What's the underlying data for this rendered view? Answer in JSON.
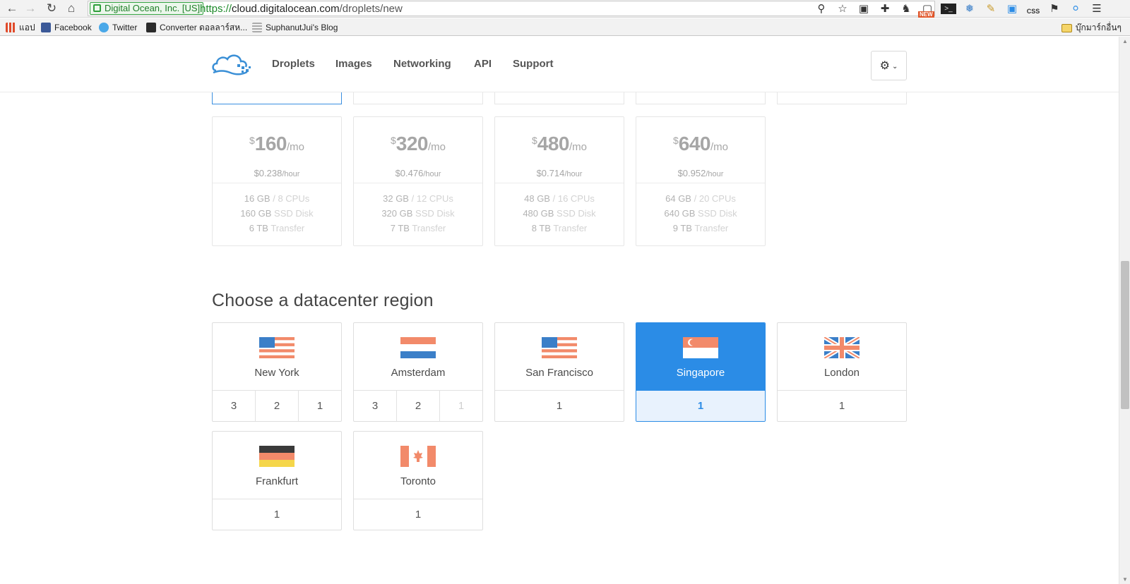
{
  "browser": {
    "ev_label": "Digital Ocean, Inc. [US]",
    "url_scheme": "https://",
    "url_host": "cloud.digitalocean.com",
    "url_path": "/droplets/new",
    "ext_badge_new": "NEW",
    "ext_badge_css": "CSS",
    "bookmarks": [
      {
        "label": "แอป"
      },
      {
        "label": "Facebook"
      },
      {
        "label": "Twitter"
      },
      {
        "label": "Converter ดอลลาร์สห..."
      },
      {
        "label": "SuphanutJui's Blog"
      }
    ],
    "other_bookmarks": "บุ๊กมาร์กอื่นๆ"
  },
  "nav": {
    "links": [
      "Droplets",
      "Images",
      "Networking",
      "API",
      "Support"
    ]
  },
  "sizes": [
    {
      "currency": "$",
      "monthly": "160",
      "per_month": "/mo",
      "hourly": "$0.238",
      "per_hour": "/hour",
      "mem": "16 GB",
      "cpu": "8 CPUs",
      "disk": "160 GB",
      "disk_label": "SSD Disk",
      "transfer": "6 TB",
      "transfer_label": "Transfer"
    },
    {
      "currency": "$",
      "monthly": "320",
      "per_month": "/mo",
      "hourly": "$0.476",
      "per_hour": "/hour",
      "mem": "32 GB",
      "cpu": "12 CPUs",
      "disk": "320 GB",
      "disk_label": "SSD Disk",
      "transfer": "7 TB",
      "transfer_label": "Transfer"
    },
    {
      "currency": "$",
      "monthly": "480",
      "per_month": "/mo",
      "hourly": "$0.714",
      "per_hour": "/hour",
      "mem": "48 GB",
      "cpu": "16 CPUs",
      "disk": "480 GB",
      "disk_label": "SSD Disk",
      "transfer": "8 TB",
      "transfer_label": "Transfer"
    },
    {
      "currency": "$",
      "monthly": "640",
      "per_month": "/mo",
      "hourly": "$0.952",
      "per_hour": "/hour",
      "mem": "64 GB",
      "cpu": "20 CPUs",
      "disk": "640 GB",
      "disk_label": "SSD Disk",
      "transfer": "9 TB",
      "transfer_label": "Transfer"
    }
  ],
  "region": {
    "heading": "Choose a datacenter region",
    "selected": "Singapore",
    "regions": [
      {
        "name": "New York",
        "flag": "us-flag-icon",
        "dcs": [
          "3",
          "2",
          "1"
        ],
        "disabled": []
      },
      {
        "name": "Amsterdam",
        "flag": "netherlands-flag-icon",
        "dcs": [
          "3",
          "2",
          "1"
        ],
        "disabled": [
          "1"
        ]
      },
      {
        "name": "San Francisco",
        "flag": "us-flag-icon",
        "dcs": [
          "1"
        ],
        "disabled": []
      },
      {
        "name": "Singapore",
        "flag": "singapore-flag-icon",
        "dcs": [
          "1"
        ],
        "disabled": []
      },
      {
        "name": "London",
        "flag": "uk-flag-icon",
        "dcs": [
          "1"
        ],
        "disabled": []
      },
      {
        "name": "Frankfurt",
        "flag": "germany-flag-icon",
        "dcs": [
          "1"
        ],
        "disabled": []
      },
      {
        "name": "Toronto",
        "flag": "canada-flag-icon",
        "dcs": [
          "1"
        ],
        "disabled": []
      }
    ]
  },
  "colors": {
    "accent": "#2b8ce6",
    "flag_red": "#f28a6a",
    "flag_blue": "#3b7fc8"
  }
}
